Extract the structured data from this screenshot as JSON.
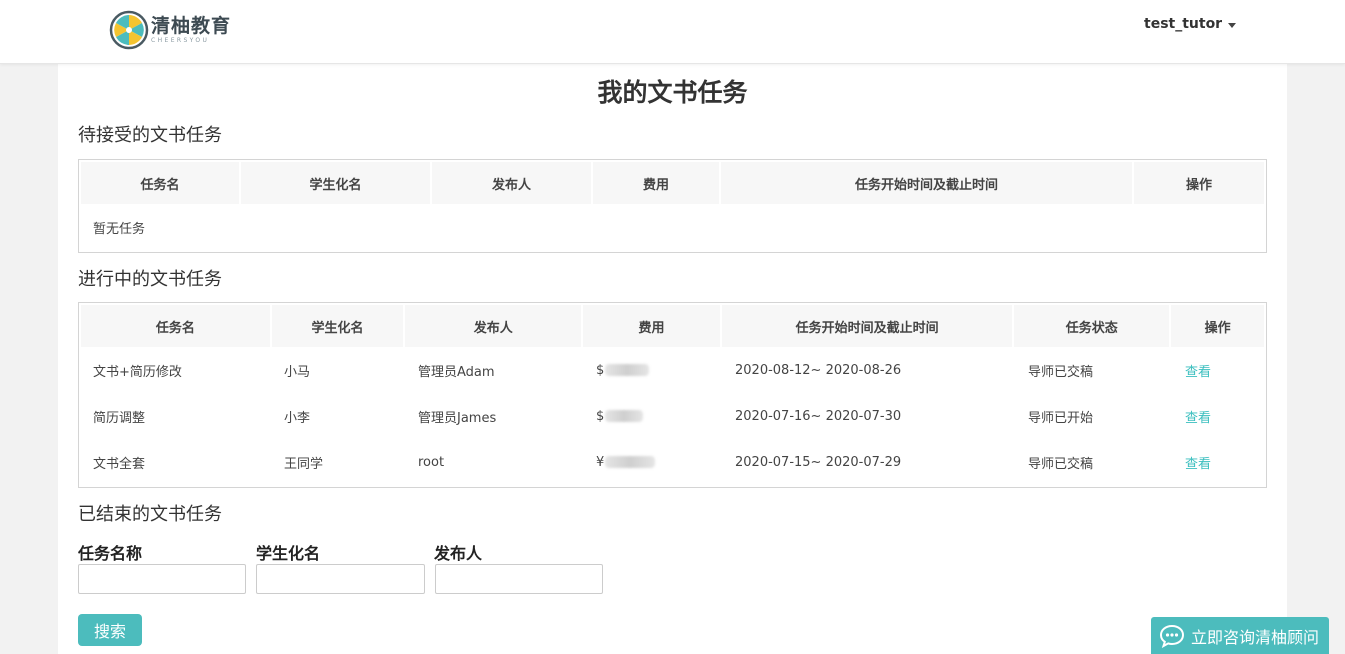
{
  "header": {
    "logo_cn": "清柚教育",
    "logo_en": "CHEERSYOU",
    "username": "test_tutor"
  },
  "page": {
    "title": "我的文书任务"
  },
  "pending": {
    "title": "待接受的文书任务",
    "columns": [
      "任务名",
      "学生化名",
      "发布人",
      "费用",
      "任务开始时间及截止时间",
      "操作"
    ],
    "empty_text": "暂无任务"
  },
  "in_progress": {
    "title": "进行中的文书任务",
    "columns": [
      "任务名",
      "学生化名",
      "发布人",
      "费用",
      "任务开始时间及截止时间",
      "任务状态",
      "操作"
    ],
    "rows": [
      {
        "name": "文书+简历修改",
        "student": "小马",
        "publisher": "管理员Adam",
        "fee_prefix": "$",
        "dates": "2020-08-12~ 2020-08-26",
        "status": "导师已交稿",
        "action": "查看"
      },
      {
        "name": "简历调整",
        "student": "小李",
        "publisher": "管理员James",
        "fee_prefix": "$",
        "dates": "2020-07-16~ 2020-07-30",
        "status": "导师已开始",
        "action": "查看"
      },
      {
        "name": "文书全套",
        "student": "王同学",
        "publisher": "root",
        "fee_prefix": "¥",
        "dates": "2020-07-15~ 2020-07-29",
        "status": "导师已交稿",
        "action": "查看"
      }
    ]
  },
  "finished": {
    "title": "已结束的文书任务",
    "filters": {
      "task_name_label": "任务名称",
      "student_label": "学生化名",
      "publisher_label": "发布人",
      "task_name_value": "",
      "student_value": "",
      "publisher_value": ""
    },
    "search_label": "搜索"
  },
  "consult": {
    "label": "立即咨询清柚顾问"
  },
  "colors": {
    "accent": "#4cbcbd",
    "link": "#3bbfbf"
  }
}
